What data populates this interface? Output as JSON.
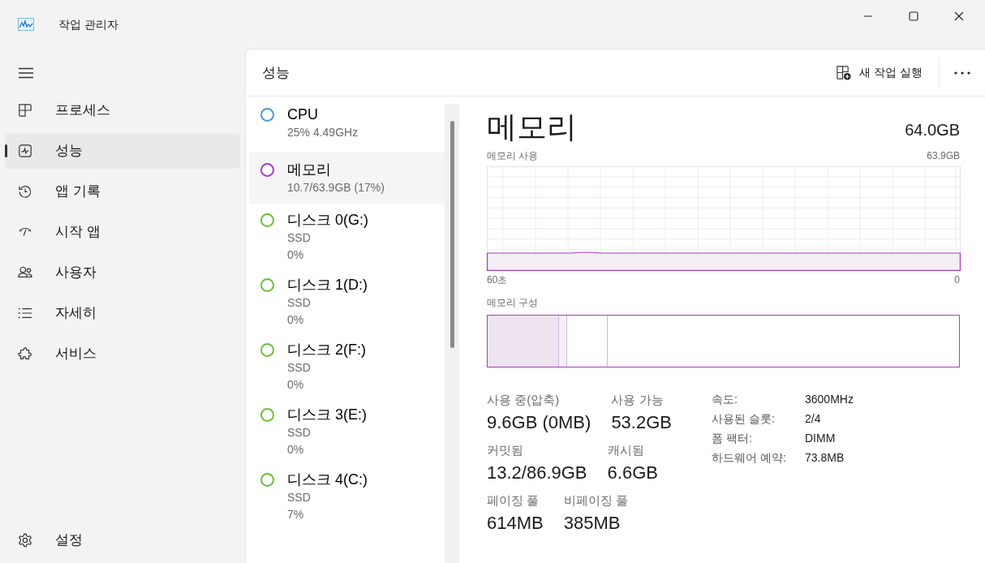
{
  "window": {
    "title": "작업 관리자"
  },
  "sidebar": {
    "items": [
      {
        "kind": "processes",
        "label": "프로세스",
        "selected": false
      },
      {
        "kind": "performance",
        "label": "성능",
        "selected": true
      },
      {
        "kind": "history",
        "label": "앱 기록",
        "selected": false
      },
      {
        "kind": "startup",
        "label": "시작 앱",
        "selected": false
      },
      {
        "kind": "users",
        "label": "사용자",
        "selected": false
      },
      {
        "kind": "details",
        "label": "자세히",
        "selected": false
      },
      {
        "kind": "services",
        "label": "서비스",
        "selected": false
      }
    ],
    "settings": "설정"
  },
  "header": {
    "title": "성능",
    "run_task": "새 작업 실행"
  },
  "devices": [
    {
      "name": "CPU",
      "lines": [
        "25%  4.49GHz"
      ],
      "color": "#4a9ad8",
      "selected": false
    },
    {
      "name": "메모리",
      "lines": [
        "10.7/63.9GB (17%)"
      ],
      "color": "#a83cc0",
      "selected": true
    },
    {
      "name": "디스크 0(G:)",
      "lines": [
        "SSD",
        "0%"
      ],
      "color": "#6cbf3a",
      "selected": false
    },
    {
      "name": "디스크 1(D:)",
      "lines": [
        "SSD",
        "0%"
      ],
      "color": "#6cbf3a",
      "selected": false
    },
    {
      "name": "디스크 2(F:)",
      "lines": [
        "SSD",
        "0%"
      ],
      "color": "#6cbf3a",
      "selected": false
    },
    {
      "name": "디스크 3(E:)",
      "lines": [
        "SSD",
        "0%"
      ],
      "color": "#6cbf3a",
      "selected": false
    },
    {
      "name": "디스크 4(C:)",
      "lines": [
        "SSD",
        "7%"
      ],
      "color": "#6cbf3a",
      "selected": false
    }
  ],
  "detail": {
    "title": "메모리",
    "total": "64.0GB",
    "usage_label": "메모리 사용",
    "usage_max": "63.9GB",
    "x_start": "60초",
    "x_end": "0",
    "composition_label": "메모리 구성",
    "stat_rows": [
      [
        {
          "label": "사용 중(압축)",
          "value": "9.6GB (0MB)"
        },
        {
          "label": "사용 가능",
          "value": "53.2GB"
        }
      ],
      [
        {
          "label": "커밋됨",
          "value": "13.2/86.9GB"
        },
        {
          "label": "캐시됨",
          "value": "6.6GB"
        }
      ],
      [
        {
          "label": "페이징 풀",
          "value": "614MB"
        },
        {
          "label": "비페이징 풀",
          "value": "385MB"
        }
      ]
    ],
    "specs": [
      {
        "label": "속도:",
        "value": "3600MHz"
      },
      {
        "label": "사용된 슬롯:",
        "value": "2/4"
      },
      {
        "label": "폼 팩터:",
        "value": "DIMM"
      },
      {
        "label": "하드웨어 예약:",
        "value": "73.8MB"
      }
    ]
  }
}
